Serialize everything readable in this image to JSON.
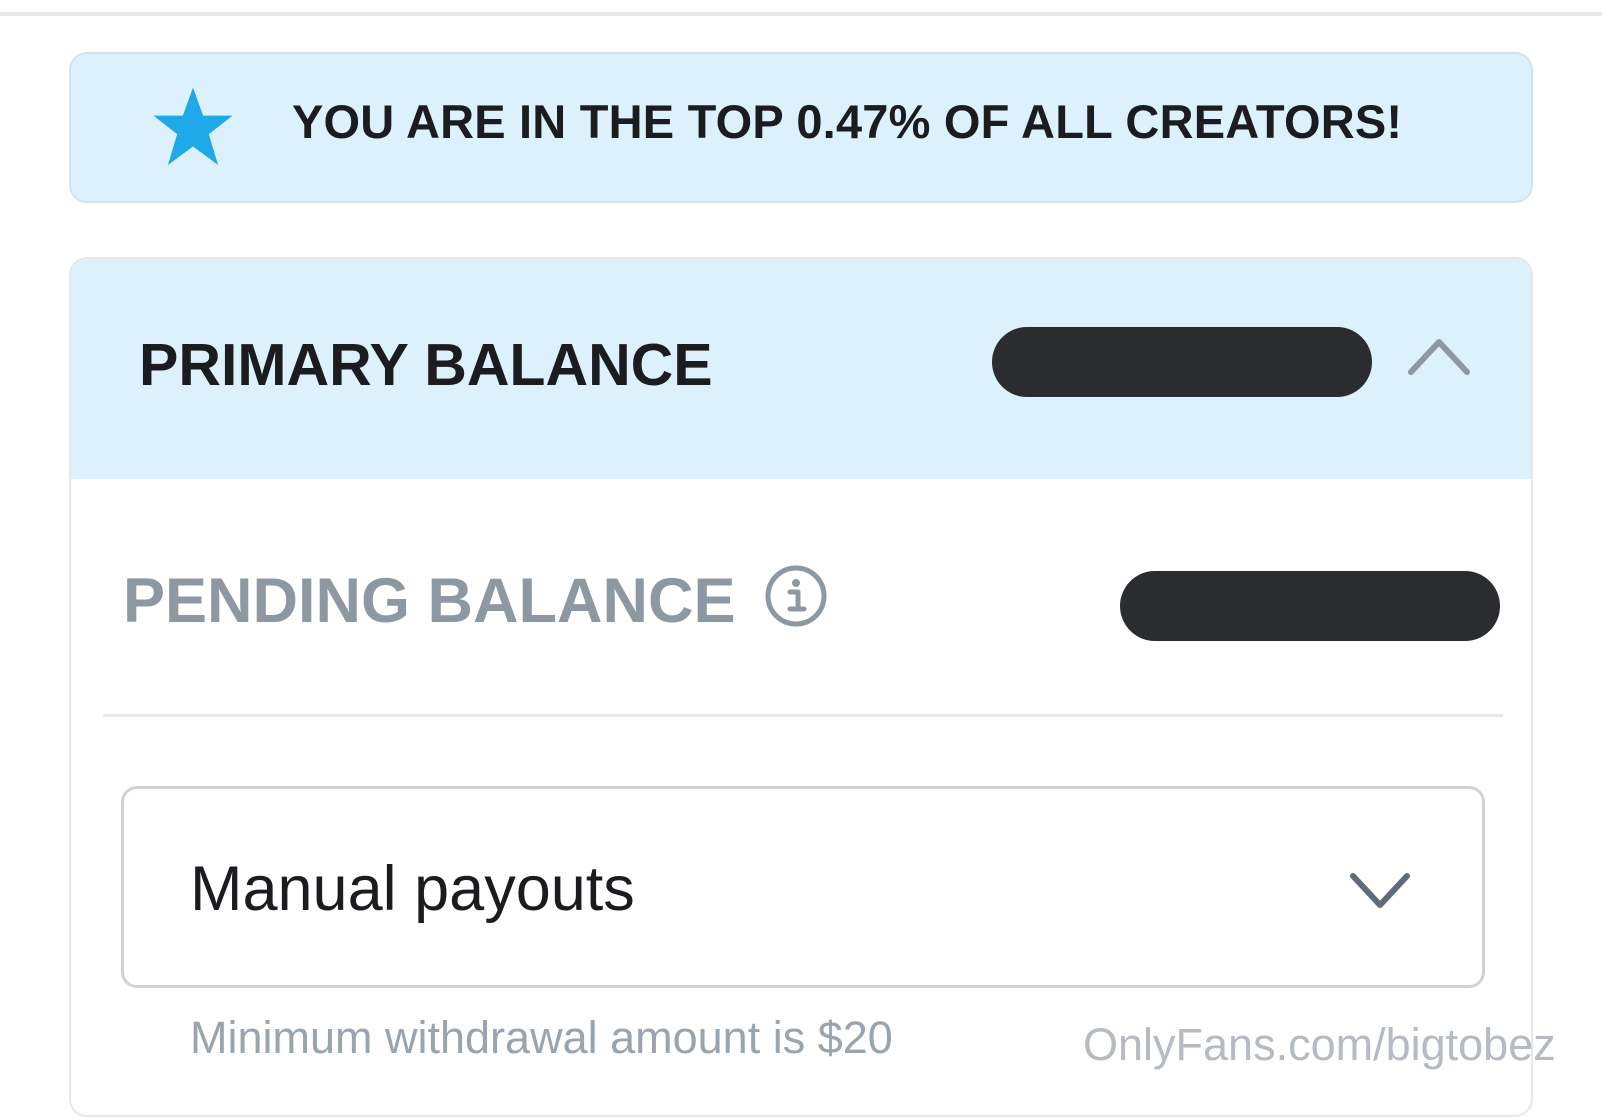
{
  "banner": {
    "icon": "star-icon",
    "text": "YOU ARE IN THE TOP 0.47% OF ALL CREATORS!"
  },
  "primary_balance": {
    "label": "PRIMARY BALANCE",
    "toggle_icon": "chevron-up-icon"
  },
  "pending_balance": {
    "label": "PENDING BALANCE",
    "info_icon": "info-icon"
  },
  "payout": {
    "selected": "Manual payouts",
    "dropdown_icon": "chevron-down-icon",
    "note": "Minimum withdrawal amount is $20"
  },
  "watermark": "OnlyFans.com/bigtobez",
  "colors": {
    "accent_star": "#1fa9e8",
    "banner_background": "#ddf1fc",
    "redaction": "#2a2c2f",
    "muted_text": "#8d98a3"
  }
}
